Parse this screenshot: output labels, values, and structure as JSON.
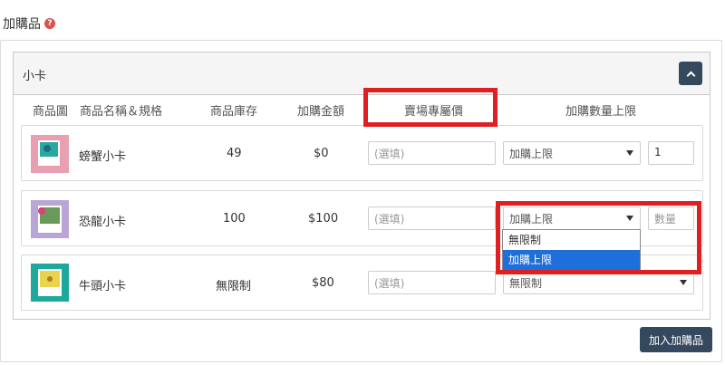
{
  "section": {
    "title": "加購品",
    "help": "?"
  },
  "panel": {
    "title": "小卡"
  },
  "columns": {
    "image": "商品圖",
    "name": "商品名稱＆規格",
    "stock": "商品庫存",
    "amount": "加購金額",
    "store_price": "賣場專屬價",
    "limit": "加購數量上限"
  },
  "rows": [
    {
      "name": "螃蟹小卡",
      "stock": "49",
      "amount": "$0",
      "price_placeholder": "(選填)",
      "limit_select": "加購上限",
      "limit_value": "1"
    },
    {
      "name": "恐龍小卡",
      "stock": "100",
      "amount": "$100",
      "price_placeholder": "(選填)",
      "limit_select": "加購上限",
      "limit_placeholder": "數量"
    },
    {
      "name": "牛頭小卡",
      "stock": "無限制",
      "amount": "$80",
      "price_placeholder": "(選填)",
      "limit_select": "無限制"
    }
  ],
  "dropdown": {
    "options": [
      "無限制",
      "加購上限"
    ],
    "selected": "加購上限"
  },
  "actions": {
    "add_label": "加入加購品"
  },
  "colors": {
    "accent": "#34495e",
    "highlight": "#e02020",
    "selected": "#1e6fd9"
  }
}
